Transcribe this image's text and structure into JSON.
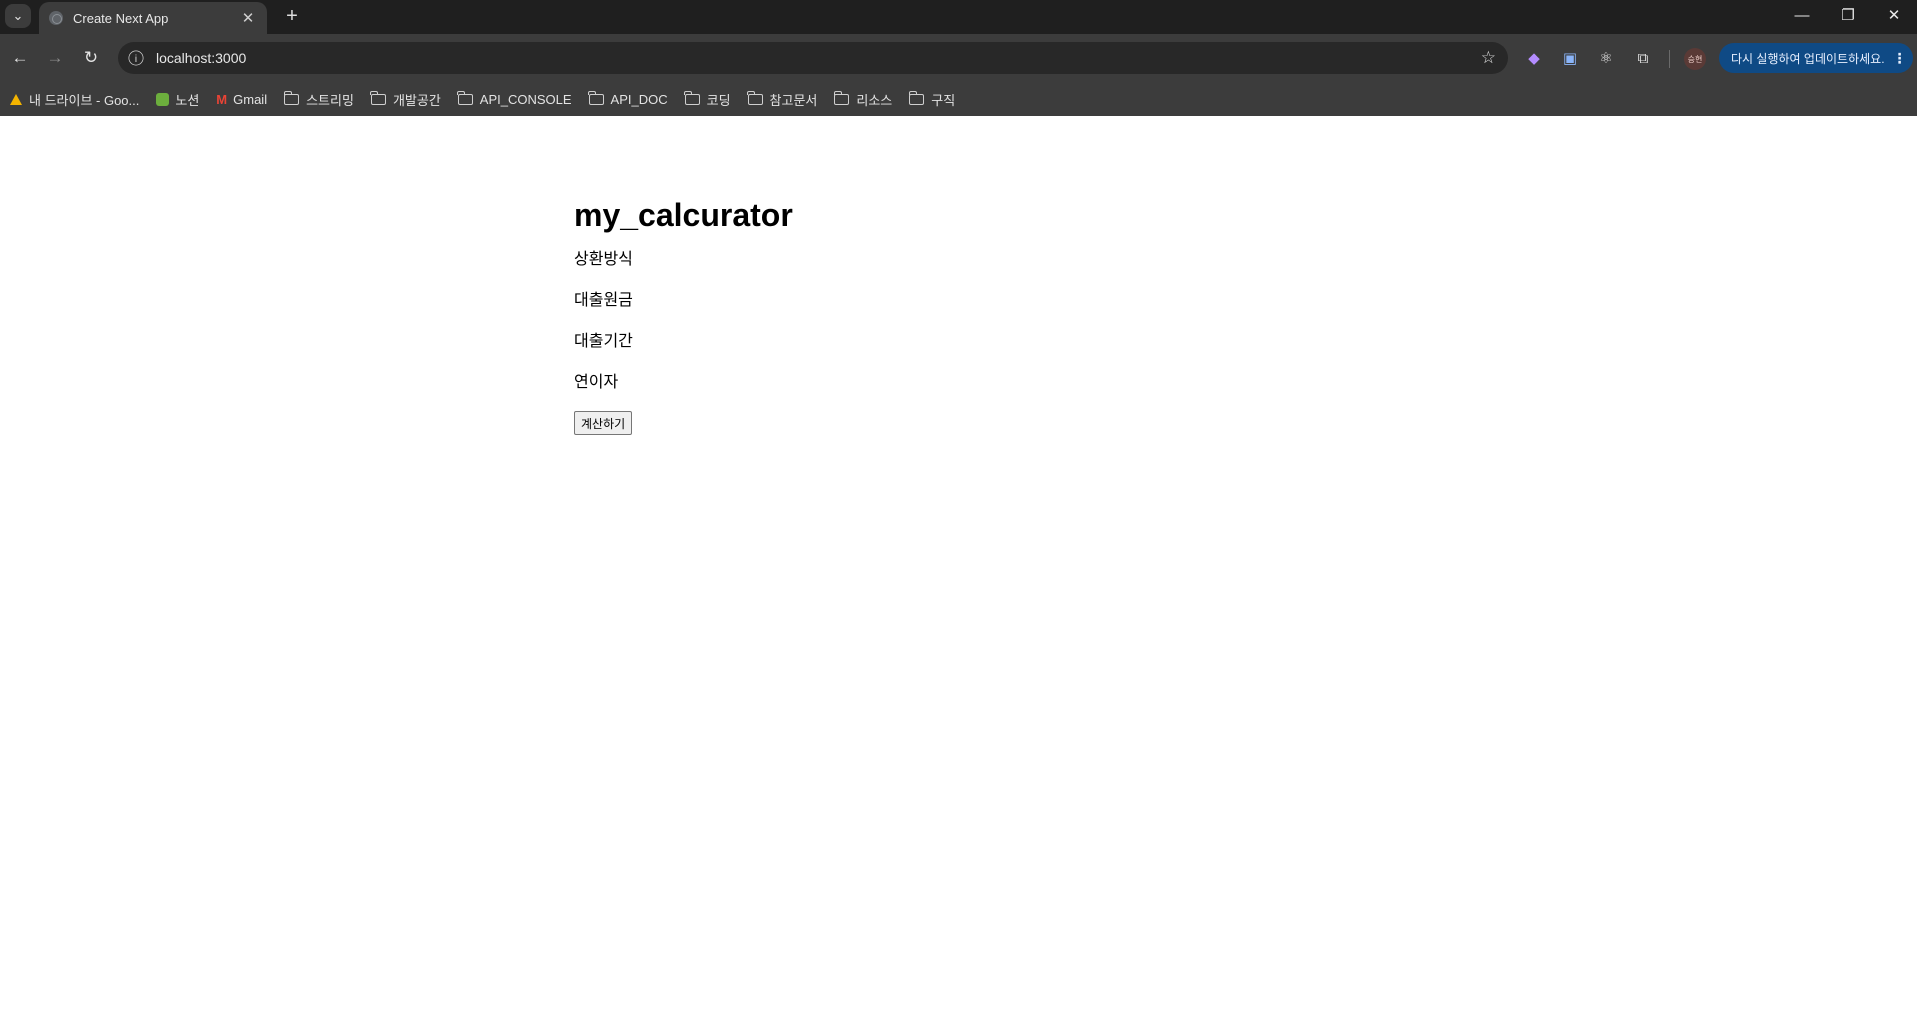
{
  "browser": {
    "tab": {
      "title": "Create Next App",
      "close_icon": "close-icon"
    },
    "url": "localhost:3000",
    "update_button_label": "다시 실행하여 업데이트하세요.",
    "profile_label": "승현",
    "bookmarks": [
      {
        "label": "내 드라이브 - Goo...",
        "icon": "drive-icon"
      },
      {
        "label": "노션",
        "icon": "notion-icon"
      },
      {
        "label": "Gmail",
        "icon": "gmail-icon"
      },
      {
        "label": "스트리밍",
        "icon": "folder-icon"
      },
      {
        "label": "개발공간",
        "icon": "folder-icon"
      },
      {
        "label": "API_CONSOLE",
        "icon": "folder-icon"
      },
      {
        "label": "API_DOC",
        "icon": "folder-icon"
      },
      {
        "label": "코딩",
        "icon": "folder-icon"
      },
      {
        "label": "참고문서",
        "icon": "folder-icon"
      },
      {
        "label": "리소스",
        "icon": "folder-icon"
      },
      {
        "label": "구직",
        "icon": "folder-icon"
      }
    ]
  },
  "page": {
    "title": "my_calcurator",
    "fields": [
      "상환방식",
      "대출원금",
      "대출기간",
      "연이자"
    ],
    "button_label": "계산하기"
  }
}
